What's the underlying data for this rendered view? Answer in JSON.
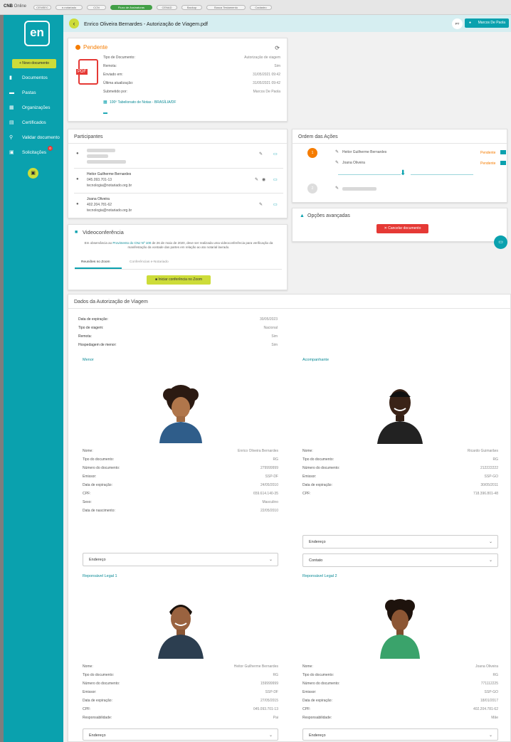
{
  "topbar": {
    "brand_bold": "CNB",
    "brand_rest": " Online",
    "chips": [
      "CENSEC",
      "e-notariado",
      "CCN",
      "Fluxo de Assinaturas",
      "CENAD",
      "Backup",
      "Busca Testamento",
      "Cadastro"
    ],
    "active_chip": "Fluxo de Assinaturas"
  },
  "sidebar": {
    "logo_text": "en",
    "new_doc_label": "Novo documento",
    "items": [
      {
        "label": "Documentos",
        "icon": "document-icon"
      },
      {
        "label": "Pastas",
        "icon": "folder-icon"
      },
      {
        "label": "Organizações",
        "icon": "organization-icon"
      },
      {
        "label": "Certificados",
        "icon": "certificate-icon"
      },
      {
        "label": "Validar documento",
        "icon": "search-icon"
      },
      {
        "label": "Solicitações",
        "icon": "requests-icon"
      }
    ],
    "requests_badge": "0"
  },
  "header": {
    "title": "Enrico Oliveira Bernardes - Autorização de Viagem.pdf",
    "lang": "PT",
    "user": "Marcos De Paola"
  },
  "status_card": {
    "status": "Pendente",
    "rows": [
      {
        "label": "Tipo de Documento:",
        "value": "Autorização de viagem"
      },
      {
        "label": "Remota:",
        "value": "Sim"
      },
      {
        "label": "Enviado em:",
        "value": "31/05/2021 09:42"
      },
      {
        "label": "Última atualização:",
        "value": "31/05/2021 09:42"
      },
      {
        "label": "Submetido por:",
        "value": "Marcos De Paola"
      }
    ],
    "office": "100º Tabelionato de Notas - BRASÍLIA/DF"
  },
  "participants": {
    "title": "Participantes",
    "list": [
      {
        "name": "Heitor Guilherme Bernardes",
        "doc": "045.093.701-13",
        "email": "tecnologia@notariado.org.br"
      },
      {
        "name": "Joana Oliveira",
        "doc": "402.204.781-62",
        "email": "tecnologia@notariado.org.br"
      }
    ]
  },
  "actions_order": {
    "title": "Ordem das Ações",
    "step1": "1",
    "step2": "2",
    "signers": [
      {
        "name": "Heitor Guilherme Bernardes",
        "status": "Pendente"
      },
      {
        "name": "Joana Oliveira",
        "status": "Pendente"
      }
    ]
  },
  "advanced": {
    "title": "Opções avançadas",
    "cancel_label": "Cancelar documento"
  },
  "video": {
    "title": "Videoconferência",
    "note_pre": "Em observância ao ",
    "note_link": "Provimento do CNJ Nº 100",
    "note_post": " de 26 de maio de 2020, deve ser realizada uma videoconferência para verificação da manifestação da vontade das partes em relação ao ato notarial lavrado.",
    "tab_active": "Reuniões no Zoom",
    "tab_inactive": "Conferências e-Notariado",
    "zoom_button": "Iniciar conferência no Zoom"
  },
  "travel": {
    "title": "Dados da Autorização de Viagem",
    "rows": [
      {
        "label": "Data de expiração:",
        "value": "30/05/2023"
      },
      {
        "label": "Tipo de viagem:",
        "value": "Nacional"
      },
      {
        "label": "Remota:",
        "value": "Sim"
      },
      {
        "label": "Hospedagem de menor:",
        "value": "Sim"
      }
    ],
    "dropdown_address": "Endereço",
    "dropdown_contact": "Contato",
    "minor": {
      "heading": "Menor",
      "rows": [
        {
          "label": "Nome:",
          "value": "Enrico Oliveira Bernardes"
        },
        {
          "label": "Tipo do documento:",
          "value": "RG"
        },
        {
          "label": "Número do documento:",
          "value": "279999999"
        },
        {
          "label": "Emissor:",
          "value": "SSP-DF"
        },
        {
          "label": "Data de expiração:",
          "value": "24/05/2010"
        },
        {
          "label": "CPF:",
          "value": "659.614.140-35"
        },
        {
          "label": "Sexo:",
          "value": "Masculino"
        },
        {
          "label": "Data de nascimento:",
          "value": "22/05/2010"
        }
      ]
    },
    "companion": {
      "heading": "Acompanhante",
      "rows": [
        {
          "label": "Nome:",
          "value": "Ricardo Guimarães"
        },
        {
          "label": "Tipo do documento:",
          "value": "RG"
        },
        {
          "label": "Número do documento:",
          "value": "212222222"
        },
        {
          "label": "Emissor:",
          "value": "SSP-GO"
        },
        {
          "label": "Data de expiração:",
          "value": "30/05/2011"
        },
        {
          "label": "CPF:",
          "value": "718.396.801-48"
        }
      ]
    },
    "guardian1": {
      "heading": "Reponsável Legal 1",
      "rows": [
        {
          "label": "Nome:",
          "value": "Heitor Guilherme Bernardes"
        },
        {
          "label": "Tipo do documento:",
          "value": "RG"
        },
        {
          "label": "Número do documento:",
          "value": "159999999"
        },
        {
          "label": "Emissor:",
          "value": "SSP-DF"
        },
        {
          "label": "Data de expiração:",
          "value": "27/05/2015"
        },
        {
          "label": "CPF:",
          "value": "045.093.701-13"
        },
        {
          "label": "Responsabilidade:",
          "value": "Pai"
        }
      ]
    },
    "guardian2": {
      "heading": "Reponsável Legal 2",
      "rows": [
        {
          "label": "Nome:",
          "value": "Joana Oliveira"
        },
        {
          "label": "Tipo do documento:",
          "value": "RG"
        },
        {
          "label": "Número do documento:",
          "value": "771112225"
        },
        {
          "label": "Emissor:",
          "value": "SSP-GO"
        },
        {
          "label": "Data de expiração:",
          "value": "18/01/2017"
        },
        {
          "label": "CPF:",
          "value": "402.204.781-62"
        },
        {
          "label": "Responsabilidade:",
          "value": "Mãe"
        }
      ]
    }
  },
  "colors": {
    "teal": "#0aa1ae",
    "lime": "#cddc39",
    "orange": "#f57c00",
    "red": "#e53935"
  }
}
